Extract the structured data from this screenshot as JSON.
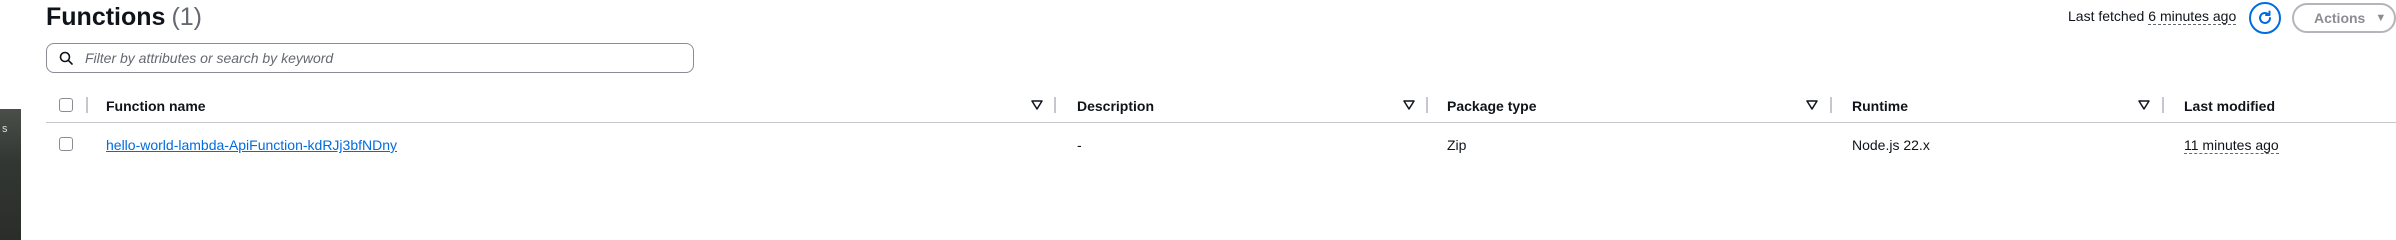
{
  "header": {
    "title": "Functions",
    "count": "(1)",
    "last_fetched_label": "Last fetched",
    "last_fetched_value": "6 minutes ago",
    "actions_label": "Actions"
  },
  "search": {
    "placeholder": "Filter by attributes or search by keyword",
    "value": ""
  },
  "table": {
    "columns": [
      "Function name",
      "Description",
      "Package type",
      "Runtime",
      "Last modified"
    ],
    "rows": [
      {
        "function_name": "hello-world-lambda-ApiFunction-kdRJj3bfNDny",
        "description": "-",
        "package_type": "Zip",
        "runtime": "Node.js 22.x",
        "last_modified": "11 minutes ago"
      }
    ]
  },
  "colors": {
    "accent": "#006ce0",
    "text": "#0f141a",
    "muted": "#656871",
    "border": "#c6c6cd"
  },
  "icons": [
    "search-icon",
    "refresh-icon",
    "caret-down-icon",
    "sort-icon"
  ]
}
